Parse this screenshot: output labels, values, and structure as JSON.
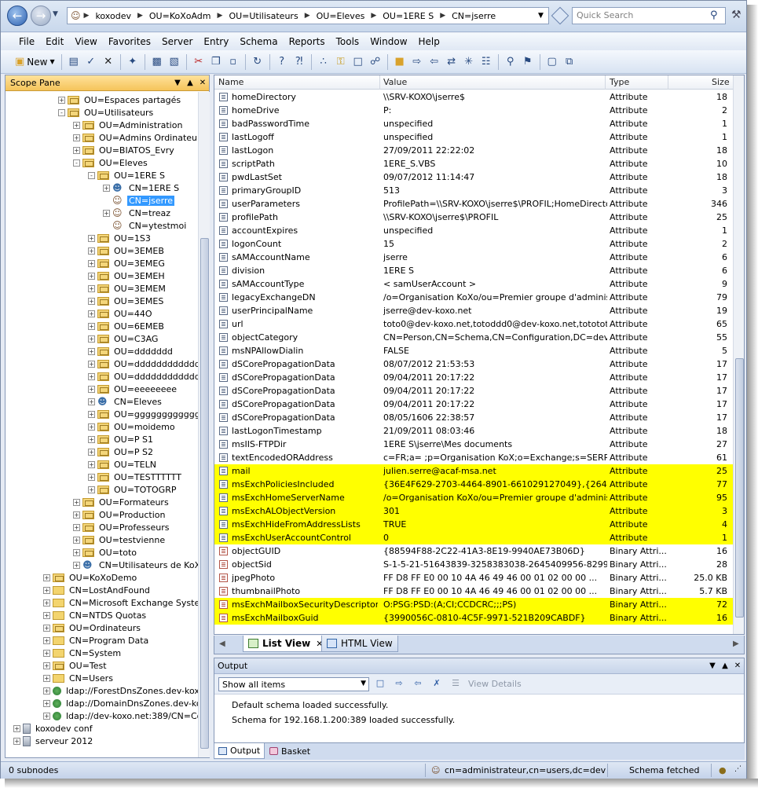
{
  "address": {
    "segments": [
      "koxodev",
      "OU=KoXoAdm",
      "OU=Utilisateurs",
      "OU=Eleves",
      "OU=1ERE S",
      "CN=jserre"
    ],
    "search_placeholder": "Quick Search"
  },
  "menu": [
    "File",
    "Edit",
    "View",
    "Favorites",
    "Server",
    "Entry",
    "Schema",
    "Reports",
    "Tools",
    "Window",
    "Help"
  ],
  "toolbar": {
    "new_label": "New"
  },
  "scope": {
    "title": "Scope Pane",
    "nodes": [
      {
        "label": "OU=Espaces partagés",
        "icon": "ou-folder-icon"
      },
      {
        "label": "OU=Utilisateurs",
        "icon": "ou-folder-icon"
      },
      {
        "label": "OU=Administration",
        "icon": "ou-folder-icon"
      },
      {
        "label": "OU=Admins Ordinateurs",
        "icon": "ou-folder-icon"
      },
      {
        "label": "OU=BIATOS_Evry",
        "icon": "ou-folder-icon"
      },
      {
        "label": "OU=Eleves",
        "icon": "ou-folder-icon"
      },
      {
        "label": "OU=1ERE S",
        "icon": "ou-folder-icon"
      },
      {
        "label": "CN=1ERE S",
        "icon": "group-icon"
      },
      {
        "label": "CN=jserre",
        "icon": "user-icon"
      },
      {
        "label": "CN=treaz",
        "icon": "user-icon"
      },
      {
        "label": "CN=ytestmoi",
        "icon": "user-icon"
      },
      {
        "label": "OU=1S3",
        "icon": "ou-folder-icon"
      },
      {
        "label": "OU=3EMEB",
        "icon": "ou-folder-icon"
      },
      {
        "label": "OU=3EMEG",
        "icon": "ou-folder-icon"
      },
      {
        "label": "OU=3EMEH",
        "icon": "ou-folder-icon"
      },
      {
        "label": "OU=3EMEM",
        "icon": "ou-folder-icon"
      },
      {
        "label": "OU=3EMES",
        "icon": "ou-folder-icon"
      },
      {
        "label": "OU=44O",
        "icon": "ou-folder-icon"
      },
      {
        "label": "OU=6EMEB",
        "icon": "ou-folder-icon"
      },
      {
        "label": "OU=C3AG",
        "icon": "ou-folder-icon"
      },
      {
        "label": "OU=ddddddd",
        "icon": "ou-folder-icon"
      },
      {
        "label": "OU=ddddddddddddddddddd",
        "icon": "ou-folder-icon"
      },
      {
        "label": "OU=ddddddddddddddddddd",
        "icon": "ou-folder-icon"
      },
      {
        "label": "OU=eeeeeeee",
        "icon": "ou-folder-icon"
      },
      {
        "label": "CN=Eleves",
        "icon": "group-icon"
      },
      {
        "label": "OU=ggggggggggggg",
        "icon": "ou-folder-icon"
      },
      {
        "label": "OU=moidemo",
        "icon": "ou-folder-icon"
      },
      {
        "label": "OU=P S1",
        "icon": "ou-folder-icon"
      },
      {
        "label": "OU=P S2",
        "icon": "ou-folder-icon"
      },
      {
        "label": "OU=TELN",
        "icon": "ou-folder-icon"
      },
      {
        "label": "OU=TESTTTTTT",
        "icon": "ou-folder-icon"
      },
      {
        "label": "OU=TOTOGRP",
        "icon": "ou-folder-icon"
      },
      {
        "label": "OU=Formateurs",
        "icon": "ou-folder-icon"
      },
      {
        "label": "OU=Production",
        "icon": "ou-folder-icon"
      },
      {
        "label": "OU=Professeurs",
        "icon": "ou-folder-icon"
      },
      {
        "label": "OU=testvienne",
        "icon": "ou-folder-icon"
      },
      {
        "label": "OU=toto",
        "icon": "ou-folder-icon"
      },
      {
        "label": "CN=Utilisateurs de KoXo Adm",
        "icon": "group-icon"
      },
      {
        "label": "OU=KoXoDemo",
        "icon": "ou-folder-icon"
      },
      {
        "label": "CN=LostAndFound",
        "icon": "container-folder-icon"
      },
      {
        "label": "CN=Microsoft Exchange System Obje",
        "icon": "container-folder-icon"
      },
      {
        "label": "CN=NTDS Quotas",
        "icon": "container-folder-icon"
      },
      {
        "label": "OU=Ordinateurs",
        "icon": "ou-folder-icon"
      },
      {
        "label": "CN=Program Data",
        "icon": "container-folder-icon"
      },
      {
        "label": "CN=System",
        "icon": "container-folder-icon"
      },
      {
        "label": "OU=Test",
        "icon": "ou-folder-icon"
      },
      {
        "label": "CN=Users",
        "icon": "container-folder-icon"
      },
      {
        "label": "ldap://ForestDnsZones.dev-koxo.net",
        "icon": "ldap-globe-icon"
      },
      {
        "label": "ldap://DomainDnsZones.dev-koxo.ne",
        "icon": "ldap-globe-icon"
      },
      {
        "label": "ldap://dev-koxo.net:389/CN=Configu",
        "icon": "ldap-globe-icon"
      },
      {
        "label": "koxodev conf",
        "icon": "server-icon"
      },
      {
        "label": "serveur 2012",
        "icon": "server-icon"
      }
    ]
  },
  "list": {
    "columns": [
      "Name",
      "Value",
      "Type",
      "Size"
    ],
    "rows": [
      {
        "name": "homeDirectory",
        "value": "\\\\SRV-KOXO\\jserre$",
        "type": "Attribute",
        "size": "18"
      },
      {
        "name": "homeDrive",
        "value": "P:",
        "type": "Attribute",
        "size": "2"
      },
      {
        "name": "badPasswordTime",
        "value": "unspecified",
        "type": "Attribute",
        "size": "1"
      },
      {
        "name": "lastLogoff",
        "value": "unspecified",
        "type": "Attribute",
        "size": "1"
      },
      {
        "name": "lastLogon",
        "value": "27/09/2011 22:22:02",
        "type": "Attribute",
        "size": "18"
      },
      {
        "name": "scriptPath",
        "value": "1ERE_S.VBS",
        "type": "Attribute",
        "size": "10"
      },
      {
        "name": "pwdLastSet",
        "value": "09/07/2012 11:14:47",
        "type": "Attribute",
        "size": "18"
      },
      {
        "name": "primaryGroupID",
        "value": "513",
        "type": "Attribute",
        "size": "3"
      },
      {
        "name": "userParameters",
        "value": "ProfilePath=\\\\SRV-KOXO\\jserre$\\PROFIL;HomeDirecto...",
        "type": "Attribute",
        "size": "346"
      },
      {
        "name": "profilePath",
        "value": "\\\\SRV-KOXO\\jserre$\\PROFIL",
        "type": "Attribute",
        "size": "25"
      },
      {
        "name": "accountExpires",
        "value": "unspecified",
        "type": "Attribute",
        "size": "1"
      },
      {
        "name": "logonCount",
        "value": "15",
        "type": "Attribute",
        "size": "2"
      },
      {
        "name": "sAMAccountName",
        "value": "jserre",
        "type": "Attribute",
        "size": "6"
      },
      {
        "name": "division",
        "value": "1ERE S",
        "type": "Attribute",
        "size": "6"
      },
      {
        "name": "sAMAccountType",
        "value": "< samUserAccount >",
        "type": "Attribute",
        "size": "9"
      },
      {
        "name": "legacyExchangeDN",
        "value": "/o=Organisation KoXo/ou=Premier groupe d'administra...",
        "type": "Attribute",
        "size": "79"
      },
      {
        "name": "userPrincipalName",
        "value": "jserre@dev-koxo.net",
        "type": "Attribute",
        "size": "19"
      },
      {
        "name": "url",
        "value": "toto0@dev-koxo.net,totoddd0@dev-koxo.net,tototot...",
        "type": "Attribute",
        "size": "65"
      },
      {
        "name": "objectCategory",
        "value": "CN=Person,CN=Schema,CN=Configuration,DC=dev-k...",
        "type": "Attribute",
        "size": "55"
      },
      {
        "name": "msNPAllowDialin",
        "value": "FALSE",
        "type": "Attribute",
        "size": "5"
      },
      {
        "name": "dSCorePropagationData",
        "value": "08/07/2012 21:53:53",
        "type": "Attribute",
        "size": "17"
      },
      {
        "name": "dSCorePropagationData",
        "value": "09/04/2011 20:17:22",
        "type": "Attribute",
        "size": "17"
      },
      {
        "name": "dSCorePropagationData",
        "value": "09/04/2011 20:17:22",
        "type": "Attribute",
        "size": "17"
      },
      {
        "name": "dSCorePropagationData",
        "value": "09/04/2011 20:17:22",
        "type": "Attribute",
        "size": "17"
      },
      {
        "name": "dSCorePropagationData",
        "value": "08/05/1606 22:38:57",
        "type": "Attribute",
        "size": "17"
      },
      {
        "name": "lastLogonTimestamp",
        "value": "21/09/2011 08:03:46",
        "type": "Attribute",
        "size": "18"
      },
      {
        "name": "msIIS-FTPDir",
        "value": "1ERE S\\jserre\\Mes documents",
        "type": "Attribute",
        "size": "27"
      },
      {
        "name": "textEncodedORAddress",
        "value": "c=FR;a= ;p=Organisation KoX;o=Exchange;s=SERRE...",
        "type": "Attribute",
        "size": "61"
      },
      {
        "name": "mail",
        "value": "julien.serre@acaf-msa.net",
        "type": "Attribute",
        "size": "25",
        "highlight": true
      },
      {
        "name": "msExchPoliciesIncluded",
        "value": "{36E4F629-2703-4464-8901-661029127049},{26491...",
        "type": "Attribute",
        "size": "77",
        "highlight": true
      },
      {
        "name": "msExchHomeServerName",
        "value": "/o=Organisation KoXo/ou=Premier groupe d'administra...",
        "type": "Attribute",
        "size": "95",
        "highlight": true
      },
      {
        "name": "msExchALObjectVersion",
        "value": "301",
        "type": "Attribute",
        "size": "3",
        "highlight": true
      },
      {
        "name": "msExchHideFromAddressLists",
        "value": "TRUE",
        "type": "Attribute",
        "size": "4",
        "highlight": true
      },
      {
        "name": "msExchUserAccountControl",
        "value": "0",
        "type": "Attribute",
        "size": "1",
        "highlight": true
      },
      {
        "name": "objectGUID",
        "value": "{88594F88-2C22-41A3-8E19-9940AE73B06D}",
        "type": "Binary Attri...",
        "size": "16",
        "binary": true
      },
      {
        "name": "objectSid",
        "value": "S-1-5-21-51643839-3258383038-2645409956-8299",
        "type": "Binary Attri...",
        "size": "28",
        "binary": true
      },
      {
        "name": "jpegPhoto",
        "value": "FF D8 FF E0 00 10 4A 46 49 46 00 01 02 00 00 ...",
        "type": "Binary Attri...",
        "size": "25.0 KB",
        "binary": true
      },
      {
        "name": "thumbnailPhoto",
        "value": "FF D8 FF E0 00 10 4A 46 49 46 00 01 02 00 00 ...",
        "type": "Binary Attri...",
        "size": "5.7 KB",
        "binary": true
      },
      {
        "name": "msExchMailboxSecurityDescriptor",
        "value": "O:PSG:PSD:(A;CI;CCDCRC;;;PS)",
        "type": "Binary Attri...",
        "size": "72",
        "binary": true,
        "highlight": true
      },
      {
        "name": "msExchMailboxGuid",
        "value": "{3990056C-0810-4C5F-9971-521B209CABDF}",
        "type": "Binary Attri...",
        "size": "16",
        "binary": true,
        "highlight": true
      }
    ]
  },
  "doc_tabs": {
    "list_view": "List View",
    "html_view": "HTML View"
  },
  "output": {
    "title": "Output",
    "filter_value": "Show all items",
    "view_details": "View Details",
    "lines": [
      "Default schema loaded successfully.",
      "Schema for 192.168.1.200:389 loaded successfully."
    ]
  },
  "bottom_tabs": {
    "output": "Output",
    "basket": "Basket"
  },
  "status": {
    "subnodes": "0 subnodes",
    "user": "cn=administrateur,cn=users,dc=dev-ko",
    "schema": "Schema fetched"
  },
  "colors": {
    "highlight": "#ffff00",
    "selection": "#3399ff",
    "pane_header": "#f5c45a"
  }
}
